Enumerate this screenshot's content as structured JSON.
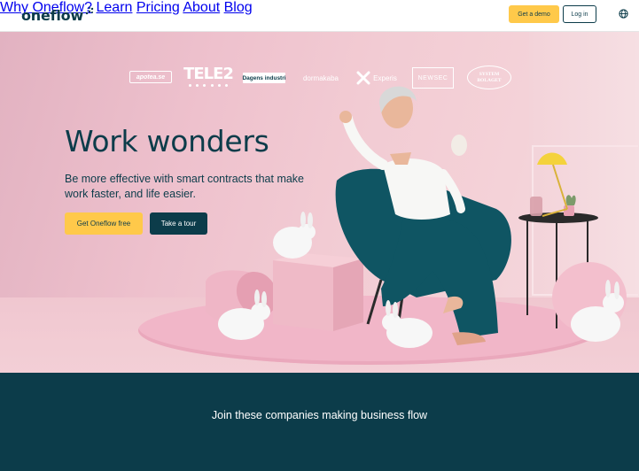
{
  "header": {
    "logo_text": "oneflow",
    "nav": [
      {
        "label": "Why Oneflow?"
      },
      {
        "label": "Learn"
      },
      {
        "label": "Pricing"
      },
      {
        "label": "About"
      },
      {
        "label": "Blog"
      }
    ],
    "demo_button": "Get a demo",
    "login_button": "Log in",
    "language_icon": "globe-icon"
  },
  "hero": {
    "title": "Work wonders",
    "subtitle": "Be more effective with smart contracts that make work faster, and life easier.",
    "primary_button": "Get Oneflow free",
    "secondary_button": "Take a tour"
  },
  "partners": {
    "title": "Join these companies making business flow",
    "logos": [
      {
        "name": "apotea.se"
      },
      {
        "name": "TELE2"
      },
      {
        "name": "Dagens industri"
      },
      {
        "name": "dormakaba"
      },
      {
        "name": "Experis"
      },
      {
        "name": "NEWSEC"
      },
      {
        "name": "SYSTEM BOLAGET"
      }
    ]
  },
  "colors": {
    "brand_dark": "#0c3c4a",
    "accent_yellow": "#ffc94a",
    "hero_pink": "#eec1cd",
    "chair_teal": "#0f5563"
  }
}
